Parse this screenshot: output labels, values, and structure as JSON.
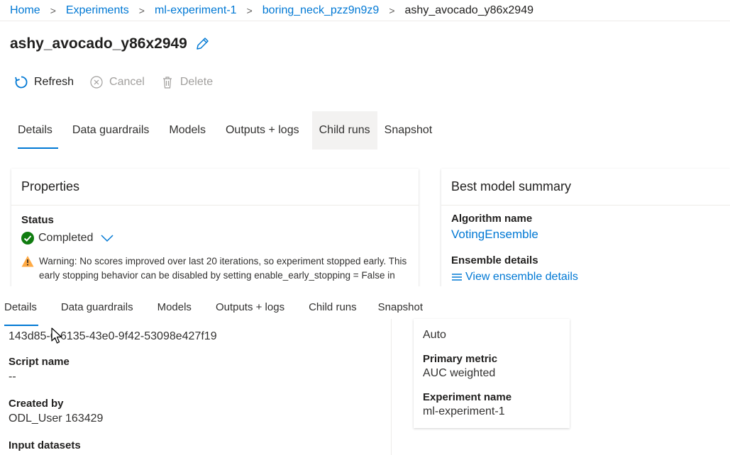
{
  "breadcrumb": {
    "home": "Home",
    "experiments": "Experiments",
    "experiment": "ml-experiment-1",
    "parent_run": "boring_neck_pzz9n9z9",
    "current": "ashy_avocado_y86x2949",
    "separator": ">"
  },
  "title": "ashy_avocado_y86x2949",
  "toolbar": {
    "refresh": "Refresh",
    "cancel": "Cancel",
    "delete": "Delete"
  },
  "tabs": [
    "Details",
    "Data guardrails",
    "Models",
    "Outputs + logs",
    "Child runs",
    "Snapshot"
  ],
  "properties": {
    "header": "Properties",
    "status_label": "Status",
    "status_value": "Completed",
    "warning_line1": "Warning: No scores improved over last 20 iterations, so experiment stopped early. This",
    "warning_line2": "early stopping behavior can be disabled by setting enable_early_stopping = False in"
  },
  "best_model": {
    "header": "Best model summary",
    "algorithm_label": "Algorithm name",
    "algorithm_value": "VotingEnsemble",
    "ensemble_label": "Ensemble details",
    "ensemble_link": "View ensemble details"
  },
  "lower": {
    "run_id": "143d85-6-6135-43e0-9f42-53098e427f19",
    "script_label": "Script name",
    "script_value": "--",
    "created_label": "Created by",
    "created_value": "ODL_User 163429",
    "input_label": "Input datasets",
    "right_partial": "Auto",
    "primary_label": "Primary metric",
    "primary_value": "AUC weighted",
    "experiment_label": "Experiment name",
    "experiment_value": "ml-experiment-1"
  },
  "colors": {
    "accent": "#0078d4",
    "success": "#107c10",
    "warning": "#ffaa44"
  }
}
